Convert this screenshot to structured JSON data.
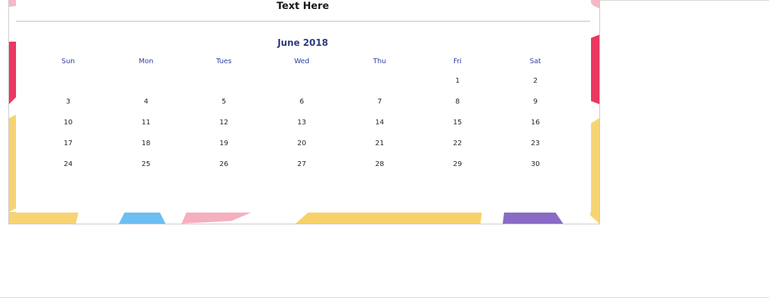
{
  "slide": {
    "title": "Text Here",
    "month_title": "June 2018"
  },
  "calendar": {
    "weekdays": [
      "Sun",
      "Mon",
      "Tues",
      "Wed",
      "Thu",
      "Fri",
      "Sat"
    ],
    "weeks": [
      [
        "",
        "",
        "",
        "",
        "",
        "1",
        "2"
      ],
      [
        "3",
        "4",
        "5",
        "6",
        "7",
        "8",
        "9"
      ],
      [
        "10",
        "11",
        "12",
        "13",
        "14",
        "15",
        "16"
      ],
      [
        "17",
        "18",
        "19",
        "20",
        "21",
        "22",
        "23"
      ],
      [
        "24",
        "25",
        "26",
        "27",
        "28",
        "29",
        "30"
      ]
    ]
  },
  "colors": {
    "title_text": "#1a1a1a",
    "month_text": "#2f3b7e",
    "weekday_text": "#2f3b9e",
    "day_text": "#1e1e1e",
    "watercolor_teal": "#2bb39a",
    "watercolor_orange": "#f6b24b",
    "watercolor_coral": "#f07a63",
    "watercolor_crimson": "#e8224f",
    "watercolor_pink": "#f4a6b8",
    "watercolor_yellow": "#f6cc5a",
    "watercolor_blue": "#5bb8ef",
    "watercolor_purple": "#7c5bbf"
  }
}
